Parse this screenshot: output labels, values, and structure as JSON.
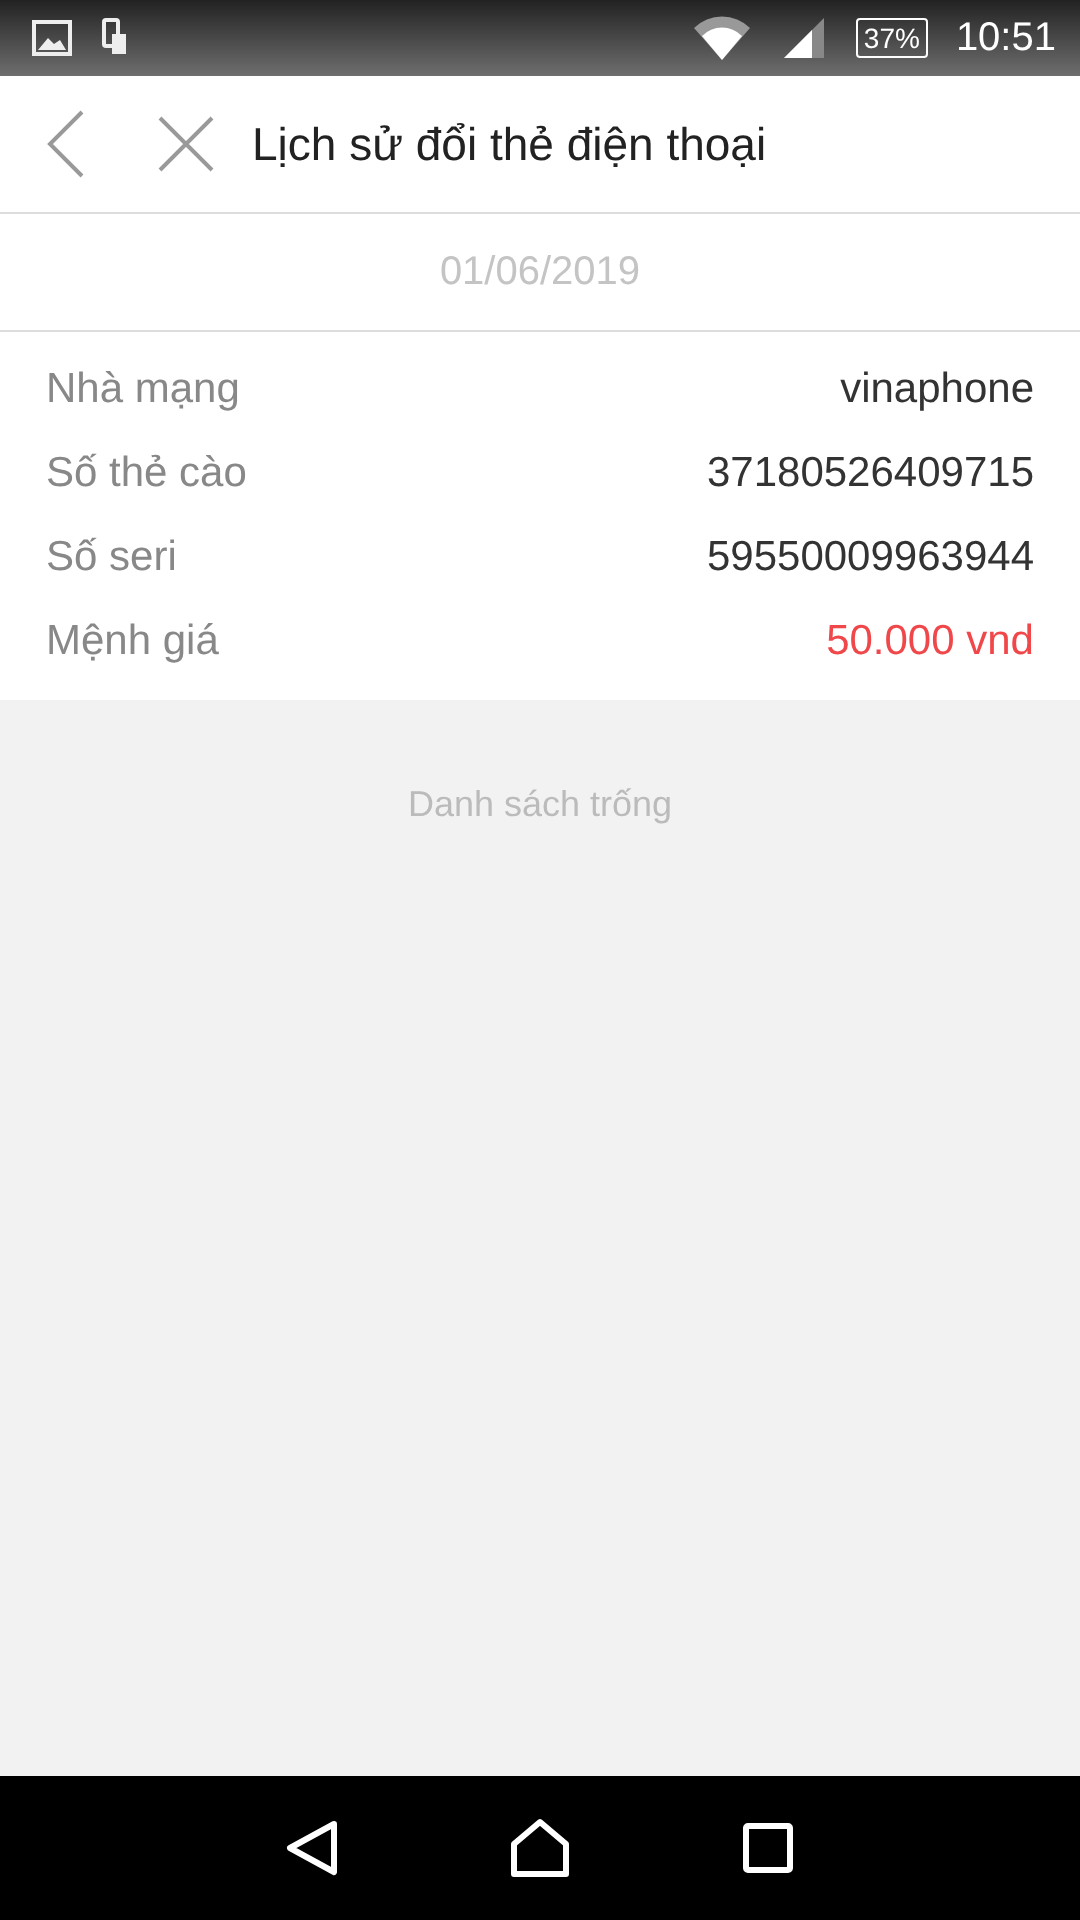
{
  "status_bar": {
    "battery": "37%",
    "time": "10:51"
  },
  "header": {
    "title": "Lịch sử đổi thẻ điện thoại"
  },
  "date": "01/06/2019",
  "details": [
    {
      "label": "Nhà mạng",
      "value": "vinaphone",
      "color": "#333333"
    },
    {
      "label": "Số thẻ cào",
      "value": "37180526409715",
      "color": "#333333"
    },
    {
      "label": "Số seri",
      "value": "59550009963944",
      "color": "#333333"
    },
    {
      "label": "Mệnh giá",
      "value": "50.000 vnd",
      "color": "#f0484a"
    }
  ],
  "empty_message": "Danh sách trống"
}
